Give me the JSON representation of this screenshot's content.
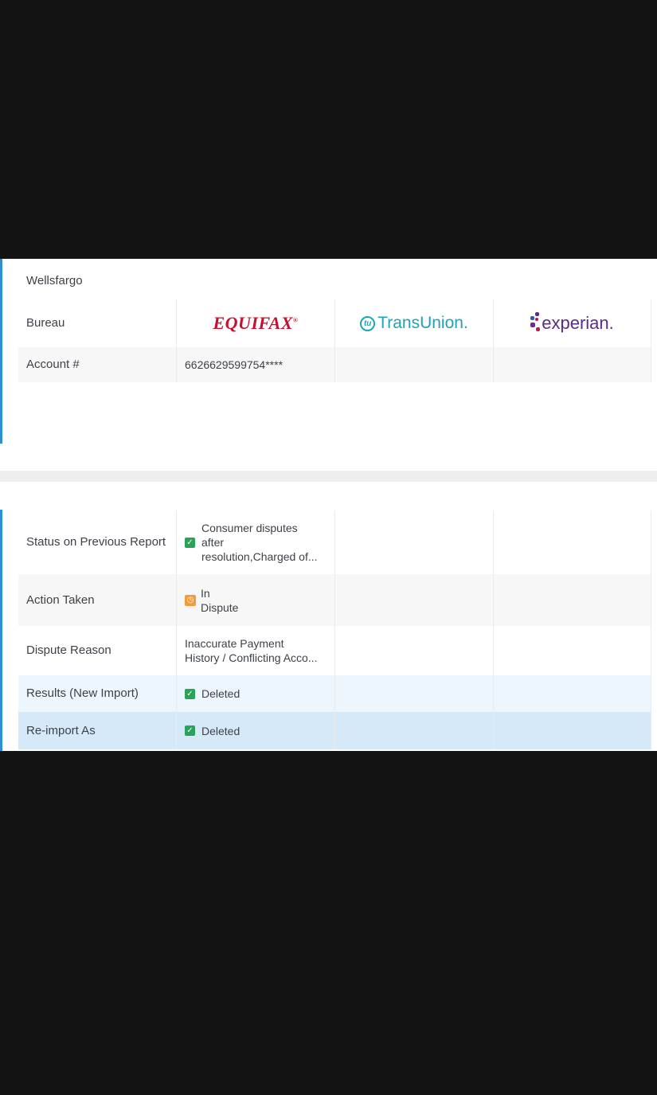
{
  "account": {
    "creditor": "Wellsfargo",
    "bureau_label": "Bureau",
    "bureaus": [
      {
        "name": "EQUIFAX",
        "mark": "®",
        "icon": "equifax-logo",
        "color": "#c8102e"
      },
      {
        "name": "TransUnion.",
        "mark": "tu",
        "icon": "transunion-logo",
        "color": "#1fa3b5"
      },
      {
        "name": "experian.",
        "icon": "experian-logo",
        "color": "#5a2d82"
      }
    ],
    "account_label": "Account #",
    "account_number": "6626629599754****"
  },
  "dispute": {
    "rows": [
      {
        "label": "Status on Previous Report",
        "status_icon": "check-icon",
        "value_lines": [
          "Consumer disputes",
          "after",
          "resolution,Charged of..."
        ]
      },
      {
        "label": "Action Taken",
        "status_icon": "clock-icon",
        "value_lines": [
          "In",
          "Dispute"
        ]
      },
      {
        "label": "Dispute Reason",
        "value_lines": [
          "Inaccurate Payment",
          "History / Conflicting Acco..."
        ]
      },
      {
        "label": "Results (New Import)",
        "status_icon": "check-icon",
        "value": "Deleted"
      },
      {
        "label": "Re-import As",
        "status_icon": "check-icon",
        "value": "Deleted"
      }
    ]
  },
  "colors": {
    "accent": "#2f8fd3",
    "check": "#27a35a",
    "warning": "#f39a3a",
    "row_alt": "#f7f7f7",
    "row_results": "#eef6fd",
    "row_reimport": "#d6e9f8"
  }
}
